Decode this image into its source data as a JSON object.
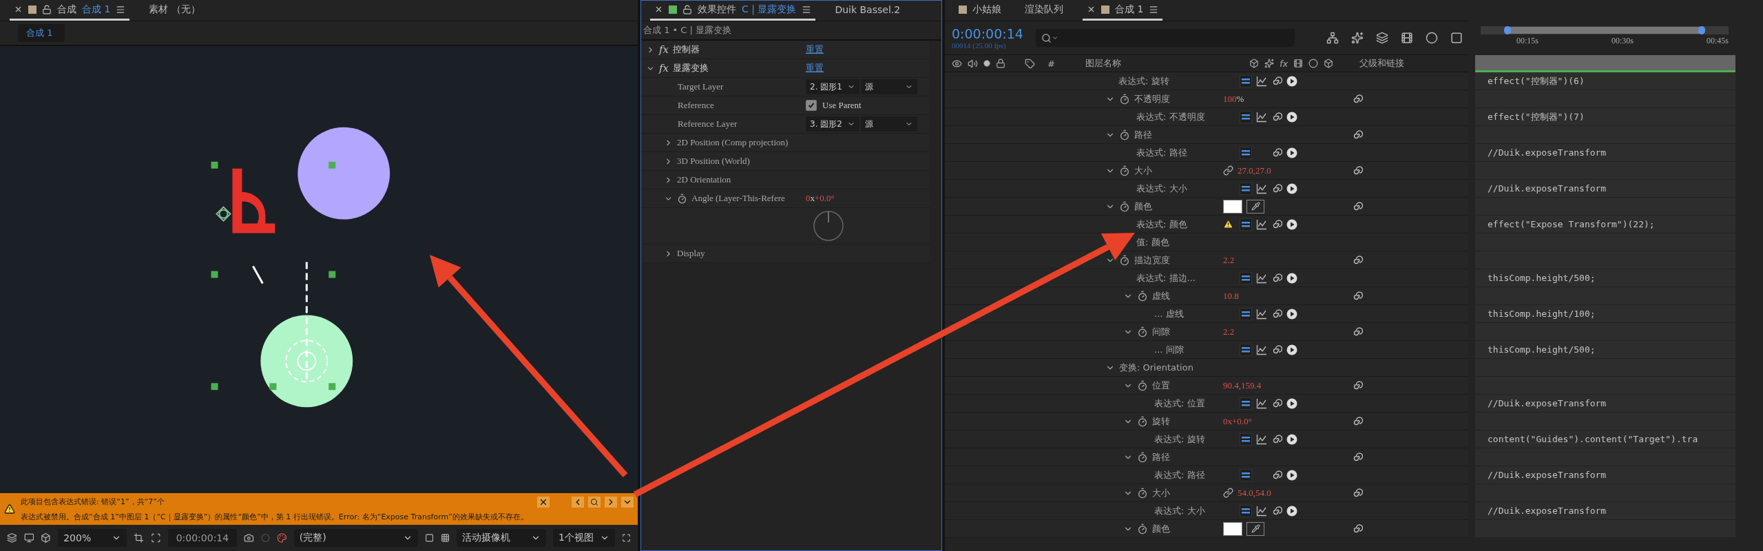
{
  "comp_panel": {
    "tabs": [
      {
        "label": "合成",
        "comp": "合成 1",
        "color": "#b5a58a",
        "selected": true
      },
      {
        "label": "素材 （无）",
        "selected": false
      }
    ],
    "subtab": "合成 1",
    "error_bar": {
      "summary": "此项目包含表达式错误: 错误“1”，共“7”个",
      "detail": "表达式被禁用。合成“合成 1”中图层 1（“C｜显露变换”）的属性“颜色”中，第 1 行出现错误。Error: 名为“Expose Transform”的效果缺失或不存在。"
    },
    "toolbar": {
      "zoom": "200%",
      "timecode": "0:00:00:14",
      "resolution": "(完整)",
      "camera": "活动摄像机",
      "views": "1个视图"
    }
  },
  "effects_panel": {
    "tabs": [
      {
        "label": "效果控件",
        "layer": "C | 显露变换",
        "color": "#5cb85c",
        "selected": true
      },
      {
        "label": "Duik Bassel.2",
        "selected": false
      }
    ],
    "breadcrumb": "合成 1 • C | 显露变换",
    "effects": [
      {
        "badge": "fx",
        "name": "控制器",
        "reset": "重置",
        "expanded": false
      },
      {
        "badge": "fx",
        "name": "显露变换",
        "reset": "重置",
        "expanded": true,
        "params": [
          {
            "kind": "layer_select",
            "name": "Target Layer",
            "layer": "2. 圆形1",
            "source": "源"
          },
          {
            "kind": "checkbox",
            "name": "Reference",
            "label": "Use Parent",
            "checked": true
          },
          {
            "kind": "layer_select",
            "name": "Reference Layer",
            "layer": "3. 圆形2",
            "source": "源"
          },
          {
            "kind": "group",
            "name": "2D Position (Comp projection)",
            "expanded": false
          },
          {
            "kind": "group",
            "name": "3D Position (World)",
            "expanded": false
          },
          {
            "kind": "group",
            "name": "2D Orientation",
            "expanded": false
          },
          {
            "kind": "angle",
            "name": "Angle (Layer-This-Refere",
            "turns": "0",
            "unit": "x",
            "degrees": "+0.0°",
            "expanded": true
          },
          {
            "kind": "group",
            "name": "Display",
            "expanded": false
          }
        ]
      }
    ]
  },
  "timeline": {
    "tabs": [
      {
        "label": "小姑娘",
        "color": "#b5a58a",
        "selected": false
      },
      {
        "label": "渲染队列",
        "selected": false
      },
      {
        "label": "合成 1",
        "color": "#b5a58a",
        "selected": true
      }
    ],
    "timecode": "0:00:00:14",
    "frame_info": "00014 (25.00 fps)",
    "columns": {
      "number": "#",
      "layer_name": "图层名称",
      "fx": "fx",
      "parent": "父级和链接"
    },
    "ruler": [
      "00:15s",
      "00:30s",
      "00:45s"
    ],
    "rows": [
      {
        "kind": "expression",
        "name": "表达式: 旋转",
        "code": "effect(\"控制器\")(6)",
        "graph": true,
        "warning": false
      },
      {
        "kind": "property",
        "name": "不透明度",
        "value": "100",
        "unit": "%",
        "expanded": true,
        "children": [
          {
            "kind": "expression",
            "name": "表达式: 不透明度",
            "code": "effect(\"控制器\")(7)",
            "graph": true,
            "warning": false
          }
        ]
      },
      {
        "kind": "property",
        "name": "路径",
        "expanded": true,
        "children": [
          {
            "kind": "expression",
            "name": "表达式: 路径",
            "code": "//Duik.exposeTransform",
            "graph": false,
            "warning": false
          }
        ]
      },
      {
        "kind": "property",
        "name": "大小",
        "linked": true,
        "value": "27.0,27.0",
        "expanded": true,
        "children": [
          {
            "kind": "expression",
            "name": "表达式: 大小",
            "code": "//Duik.exposeTransform",
            "graph": true,
            "warning": false
          }
        ]
      },
      {
        "kind": "property",
        "name": "颜色",
        "color": "#ffffff",
        "expanded": true,
        "children": [
          {
            "kind": "expression",
            "name": "表达式: 颜色",
            "code": "effect(\"Expose Transform\")(22);",
            "graph": true,
            "warning": true
          },
          {
            "kind": "value",
            "name": "值: 颜色"
          }
        ]
      },
      {
        "kind": "property",
        "name": "描边宽度",
        "value": "2.2",
        "expanded": true,
        "children": [
          {
            "kind": "expression",
            "name": "表达式: 描边...",
            "code": "thisComp.height/500;",
            "graph": true,
            "warning": false
          },
          {
            "kind": "property",
            "name": "虚线",
            "value": "10.8",
            "expanded": true,
            "children": [
              {
                "kind": "expression",
                "name": "... 虚线",
                "code": "thisComp.height/100;",
                "graph": true,
                "warning": false
              }
            ]
          },
          {
            "kind": "property",
            "name": "间隙",
            "value": "2.2",
            "expanded": true,
            "children": [
              {
                "kind": "expression",
                "name": "... 间隙",
                "code": "thisComp.height/500;",
                "graph": true,
                "warning": false
              }
            ]
          }
        ]
      },
      {
        "kind": "group",
        "name": "变换: Orientation",
        "expanded": true,
        "children": [
          {
            "kind": "property",
            "name": "位置",
            "value": "90.4,159.4",
            "expanded": true,
            "children": [
              {
                "kind": "expression",
                "name": "表达式: 位置",
                "code": "//Duik.exposeTransform",
                "graph": true,
                "warning": false
              }
            ]
          },
          {
            "kind": "property",
            "name": "旋转",
            "value": "0x+0.0°",
            "expanded": true,
            "children": [
              {
                "kind": "expression",
                "name": "表达式: 旋转",
                "code": "content(\"Guides\").content(\"Target\").tra",
                "graph": true,
                "warning": false
              }
            ]
          },
          {
            "kind": "property",
            "name": "路径",
            "expanded": true,
            "children": [
              {
                "kind": "expression",
                "name": "表达式: 路径",
                "code": "//Duik.exposeTransform",
                "graph": false,
                "warning": false
              }
            ]
          },
          {
            "kind": "property",
            "name": "大小",
            "linked": true,
            "value": "54.0,54.0",
            "expanded": true,
            "children": [
              {
                "kind": "expression",
                "name": "表达式: 大小",
                "code": "//Duik.exposeTransform",
                "graph": true,
                "warning": false
              }
            ]
          },
          {
            "kind": "property",
            "name": "颜色",
            "color": "#ffffff",
            "expanded": true
          }
        ]
      }
    ]
  }
}
